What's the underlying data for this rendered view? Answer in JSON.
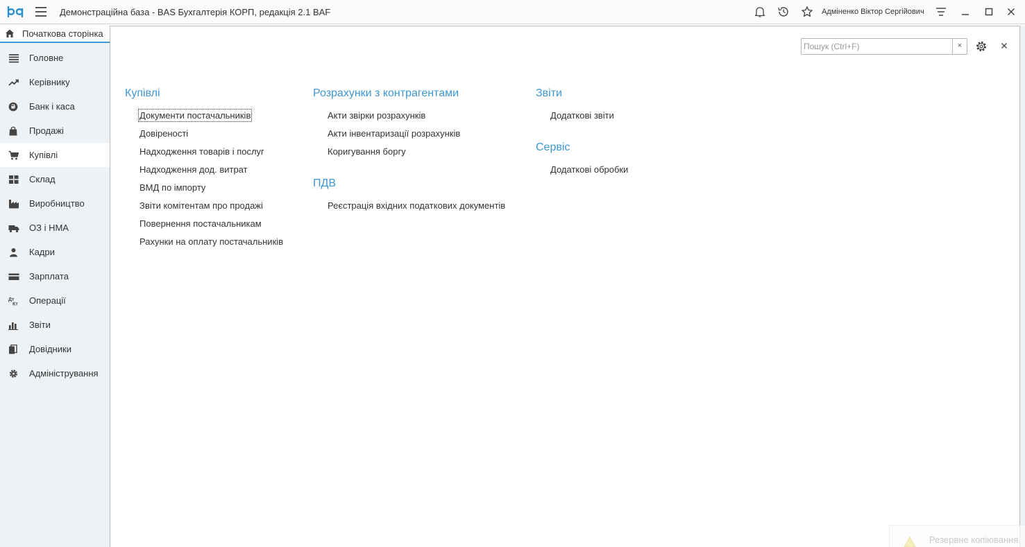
{
  "titlebar": {
    "app_title": "Демонстраційна база - BAS Бухгалтерія КОРП, редакція 2.1 BAF",
    "user_name": "Адміненко Віктор Сергійович",
    "icons": [
      "logo-icon",
      "menu-icon",
      "bell-icon",
      "history-icon",
      "star-icon",
      "settings-menu-icon",
      "minimize-icon",
      "maximize-icon",
      "close-icon"
    ]
  },
  "sidebar": {
    "home_label": "Початкова сторінка",
    "items": [
      {
        "label": "Головне",
        "icon": "list-icon"
      },
      {
        "label": "Керівнику",
        "icon": "trend-icon"
      },
      {
        "label": "Банк і каса",
        "icon": "currency-icon"
      },
      {
        "label": "Продажі",
        "icon": "bag-icon"
      },
      {
        "label": "Купівлі",
        "icon": "cart-icon",
        "active": true
      },
      {
        "label": "Склад",
        "icon": "grid-icon"
      },
      {
        "label": "Виробництво",
        "icon": "factory-icon"
      },
      {
        "label": "ОЗ і НМА",
        "icon": "truck-icon"
      },
      {
        "label": "Кадри",
        "icon": "person-icon"
      },
      {
        "label": "Зарплата",
        "icon": "card-icon"
      },
      {
        "label": "Операції",
        "icon": "dt-kt-icon"
      },
      {
        "label": "Звіти",
        "icon": "bar-chart-icon"
      },
      {
        "label": "Довідники",
        "icon": "books-icon"
      },
      {
        "label": "Адміністрування",
        "icon": "gear-icon"
      }
    ]
  },
  "search": {
    "placeholder": "Пошук (Ctrl+F)",
    "value": "",
    "clear_label": "×"
  },
  "sections": {
    "kupivli": {
      "title": "Купівлі",
      "links": [
        "Документи постачальників",
        "Довіреності",
        "Надходження товарів і послуг",
        "Надходження дод. витрат",
        "ВМД по імпорту",
        "Звіти комітентам про продажі",
        "Повернення постачальникам",
        "Рахунки на оплату постачальників"
      ]
    },
    "rozrakhunky": {
      "title": "Розрахунки з контрагентами",
      "links": [
        "Акти звірки розрахунків",
        "Акти інвентаризації розрахунків",
        "Коригування боргу"
      ]
    },
    "pdv": {
      "title": "ПДВ",
      "links": [
        "Реєстрація вхідних податкових документів"
      ]
    },
    "zvity": {
      "title": "Звіти",
      "links": [
        "Додаткові звіти"
      ]
    },
    "servis": {
      "title": "Сервіс",
      "links": [
        "Додаткові обробки"
      ]
    }
  },
  "notification": {
    "text": "Резервне копіювання"
  },
  "colors": {
    "accent": "#3d97d4",
    "sidebar_bg": "#eef2f5",
    "text": "#333333"
  }
}
